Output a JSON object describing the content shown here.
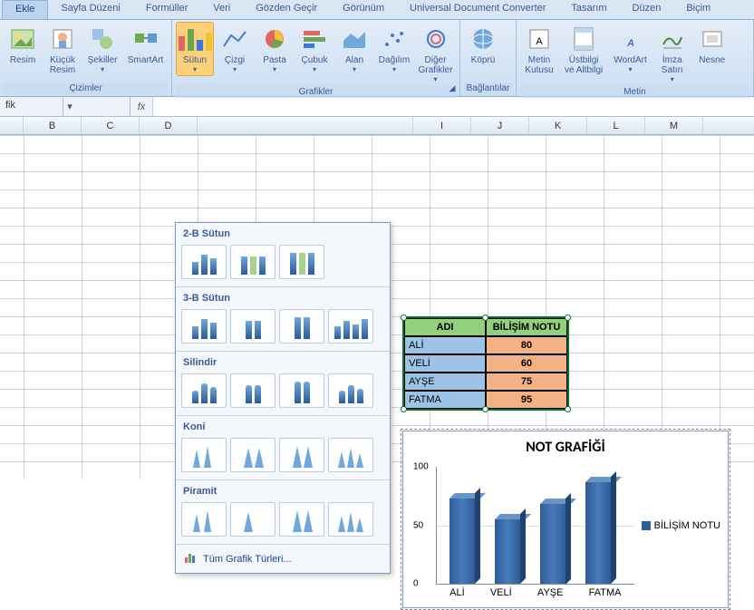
{
  "tabs": {
    "active": "Ekle",
    "items": [
      "Ekle",
      "Sayfa Düzeni",
      "Formüller",
      "Veri",
      "Gözden Geçir",
      "Görünüm",
      "Universal Document Converter",
      "Tasarım",
      "Düzen",
      "Biçim"
    ]
  },
  "ribbon": {
    "illustrations": {
      "label": "Çizimler",
      "picture": "Resim",
      "clipart": "Küçük\nResim",
      "shapes": "Şekiller",
      "smartart": "SmartArt"
    },
    "charts": {
      "label": "Grafikler",
      "column": "Sütun",
      "line": "Çizgi",
      "pie": "Pasta",
      "bar": "Çubuk",
      "area": "Alan",
      "scatter": "Dağılım",
      "other": "Diğer\nGrafikler"
    },
    "links": {
      "label": "Bağlantılar",
      "hyperlink": "Köprü"
    },
    "text": {
      "label": "Metin",
      "textbox": "Metin\nKutusu",
      "headerfooter": "Üstbilgi\nve Altbilgi",
      "wordart": "WordArt",
      "signature": "İmza\nSatırı",
      "object": "Nesne"
    }
  },
  "formula_bar": {
    "cell": "fik",
    "fx": "fx"
  },
  "columns": [
    "B",
    "C",
    "D",
    "",
    "",
    "",
    "",
    "I",
    "J",
    "K",
    "L",
    "M"
  ],
  "dropdown": {
    "sections": [
      {
        "title": "2-B Sütun",
        "count": 3
      },
      {
        "title": "3-B Sütun",
        "count": 4
      },
      {
        "title": "Silindir",
        "count": 4
      },
      {
        "title": "Koni",
        "count": 4
      },
      {
        "title": "Piramit",
        "count": 4
      }
    ],
    "footer": "Tüm Grafik Türleri..."
  },
  "table": {
    "headers": [
      "ADI",
      "BİLİŞİM NOTU"
    ],
    "rows": [
      [
        "ALİ",
        "80"
      ],
      [
        "VELİ",
        "60"
      ],
      [
        "AYŞE",
        "75"
      ],
      [
        "FATMA",
        "95"
      ]
    ]
  },
  "chart_data": {
    "type": "bar",
    "title": "NOT GRAFİĞİ",
    "categories": [
      "ALİ",
      "VELİ",
      "AYŞE",
      "FATMA"
    ],
    "series": [
      {
        "name": "BİLİŞİM NOTU",
        "values": [
          80,
          60,
          75,
          95
        ]
      }
    ],
    "ylim": [
      0,
      100
    ],
    "yticks": [
      0,
      50,
      100
    ],
    "xlabel": "",
    "ylabel": ""
  }
}
